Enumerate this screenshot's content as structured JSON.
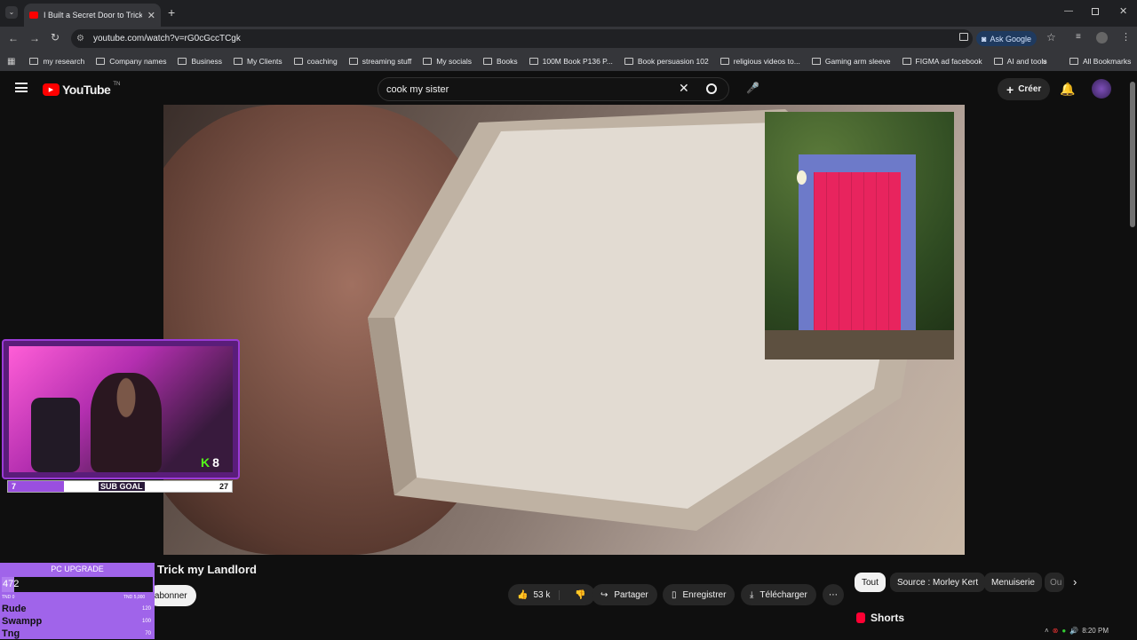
{
  "browser": {
    "tab_title": "I Built a Secret Door to Trick my",
    "url": "youtube.com/watch?v=rG0cGccTCgk",
    "ask_google": "Ask Google",
    "bookmarks": [
      "my research",
      "Company names",
      "Business",
      "My Clients",
      "coaching",
      "streaming stuff",
      "My socials",
      "Books",
      "100M Book P136 P...",
      "Book persuasion 102",
      "religious videos to...",
      "Gaming arm sleeve",
      "FIGMA ad facebook",
      "AI and tools"
    ],
    "all_bookmarks": "All Bookmarks"
  },
  "youtube": {
    "logo_text": "YouTube",
    "logo_sup": "TN",
    "search_value": "cook my sister",
    "create_label": "Créer",
    "video_title_partial": "Trick my Landlord",
    "subscribe_partial": "'abonner",
    "likes": "53 k",
    "share_label": "Partager",
    "save_label": "Enregistrer",
    "download_label": "Télécharger",
    "chips": [
      "Tout",
      "Source : Morley Kert",
      "Menuiserie",
      "Ou"
    ],
    "shorts_label": "Shorts"
  },
  "overlay": {
    "sub_goal_label": "SUB GOAL",
    "sub_goal_current": "7",
    "sub_goal_target": "27",
    "kick_count": "8",
    "pc_upgrade_label": "PC UPGRADE",
    "pc_upgrade_value": "472",
    "pc_min": "TND 0",
    "pc_max": "TND 5,000",
    "leaderboard": [
      {
        "name": "Rude",
        "amount": "120"
      },
      {
        "name": "Swampp",
        "amount": "100"
      },
      {
        "name": "Tng",
        "amount": "70"
      }
    ]
  },
  "taskbar": {
    "time": "8:20 PM"
  },
  "colors": {
    "yt_red": "#ff0000",
    "overlay_purple": "#a064ea",
    "door_pink": "#e8245e"
  }
}
